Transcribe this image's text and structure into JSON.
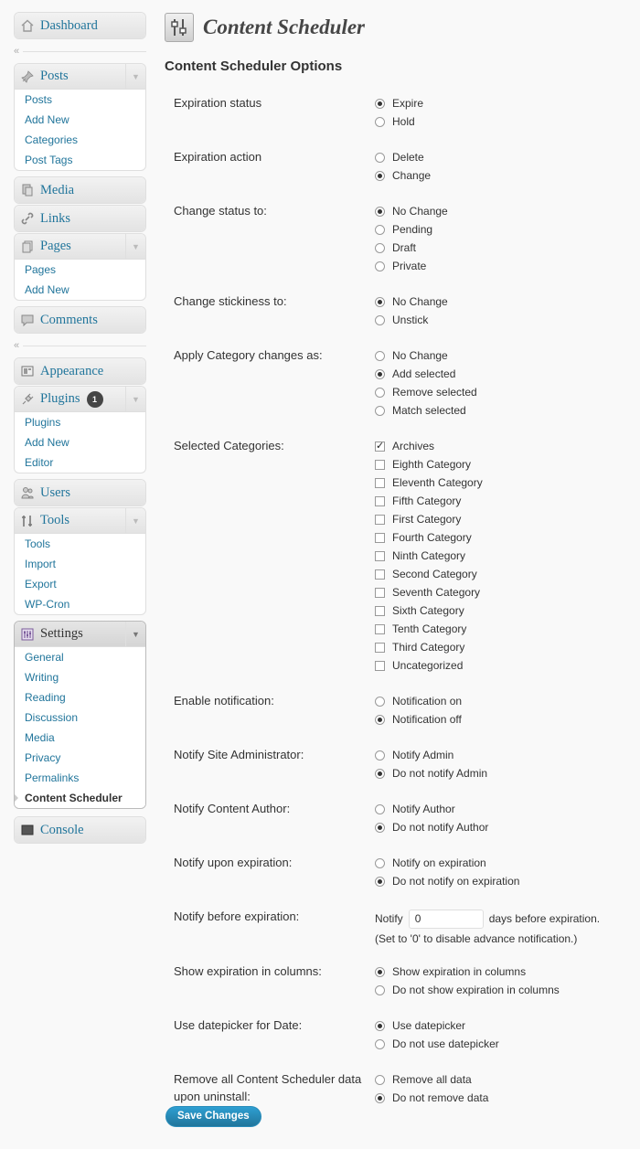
{
  "sidebar": {
    "dashboard": "Dashboard",
    "posts": {
      "label": "Posts",
      "items": [
        "Posts",
        "Add New",
        "Categories",
        "Post Tags"
      ]
    },
    "media": "Media",
    "links": "Links",
    "pages": {
      "label": "Pages",
      "items": [
        "Pages",
        "Add New"
      ]
    },
    "comments": "Comments",
    "appearance": "Appearance",
    "plugins": {
      "label": "Plugins",
      "badge": "1",
      "items": [
        "Plugins",
        "Add New",
        "Editor"
      ]
    },
    "users": "Users",
    "tools": {
      "label": "Tools",
      "items": [
        "Tools",
        "Import",
        "Export",
        "WP-Cron"
      ]
    },
    "settings": {
      "label": "Settings",
      "items": [
        "General",
        "Writing",
        "Reading",
        "Discussion",
        "Media",
        "Privacy",
        "Permalinks",
        "Content Scheduler"
      ]
    },
    "console": "Console",
    "collapse_glyph": "«"
  },
  "page": {
    "title": "Content Scheduler",
    "section_title": "Content Scheduler Options"
  },
  "options": [
    {
      "label": "Expiration status",
      "choices": [
        "Expire",
        "Hold"
      ],
      "selected": 0
    },
    {
      "label": "Expiration action",
      "choices": [
        "Delete",
        "Change"
      ],
      "selected": 1
    },
    {
      "label": "Change status to:",
      "choices": [
        "No Change",
        "Pending",
        "Draft",
        "Private"
      ],
      "selected": 0
    },
    {
      "label": "Change stickiness to:",
      "choices": [
        "No Change",
        "Unstick"
      ],
      "selected": 0
    },
    {
      "label": "Apply Category changes as:",
      "choices": [
        "No Change",
        "Add selected",
        "Remove selected",
        "Match selected"
      ],
      "selected": 1
    },
    {
      "label": "Selected Categories:",
      "checkboxes": [
        "Archives",
        "Eighth Category",
        "Eleventh Category",
        "Fifth Category",
        "First Category",
        "Fourth Category",
        "Ninth Category",
        "Second Category",
        "Seventh Category",
        "Sixth Category",
        "Tenth Category",
        "Third Category",
        "Uncategorized"
      ],
      "checked": [
        0
      ]
    },
    {
      "label": "Enable notification:",
      "choices": [
        "Notification on",
        "Notification off"
      ],
      "selected": 1
    },
    {
      "label": "Notify Site Administrator:",
      "choices": [
        "Notify Admin",
        "Do not notify Admin"
      ],
      "selected": 1
    },
    {
      "label": "Notify Content Author:",
      "choices": [
        "Notify Author",
        "Do not notify Author"
      ],
      "selected": 1
    },
    {
      "label": "Notify upon expiration:",
      "choices": [
        "Notify on expiration",
        "Do not notify on expiration"
      ],
      "selected": 1
    }
  ],
  "notify_before": {
    "label": "Notify before expiration:",
    "prefix": "Notify",
    "value": "0",
    "suffix": "days before expiration.",
    "hint": "(Set to '0' to disable advance notification.)"
  },
  "options2": [
    {
      "label": "Show expiration in columns:",
      "choices": [
        "Show expiration in columns",
        "Do not show expiration in columns"
      ],
      "selected": 0
    },
    {
      "label": "Use datepicker for Date:",
      "choices": [
        "Use datepicker",
        "Do not use datepicker"
      ],
      "selected": 0
    },
    {
      "label": "Remove all Content Scheduler data upon uninstall:",
      "choices": [
        "Remove all data",
        "Do not remove data"
      ],
      "selected": 1
    }
  ],
  "save_label": "Save Changes",
  "icons": {
    "dashboard": "house-icon",
    "posts": "pin-icon",
    "media": "media-icon",
    "links": "link-icon",
    "pages": "pages-icon",
    "comments": "comment-icon",
    "appearance": "appearance-icon",
    "plugins": "plug-icon",
    "users": "users-icon",
    "tools": "wrench-icon",
    "settings": "settings-icon",
    "console": "console-icon",
    "title": "sliders-icon"
  }
}
